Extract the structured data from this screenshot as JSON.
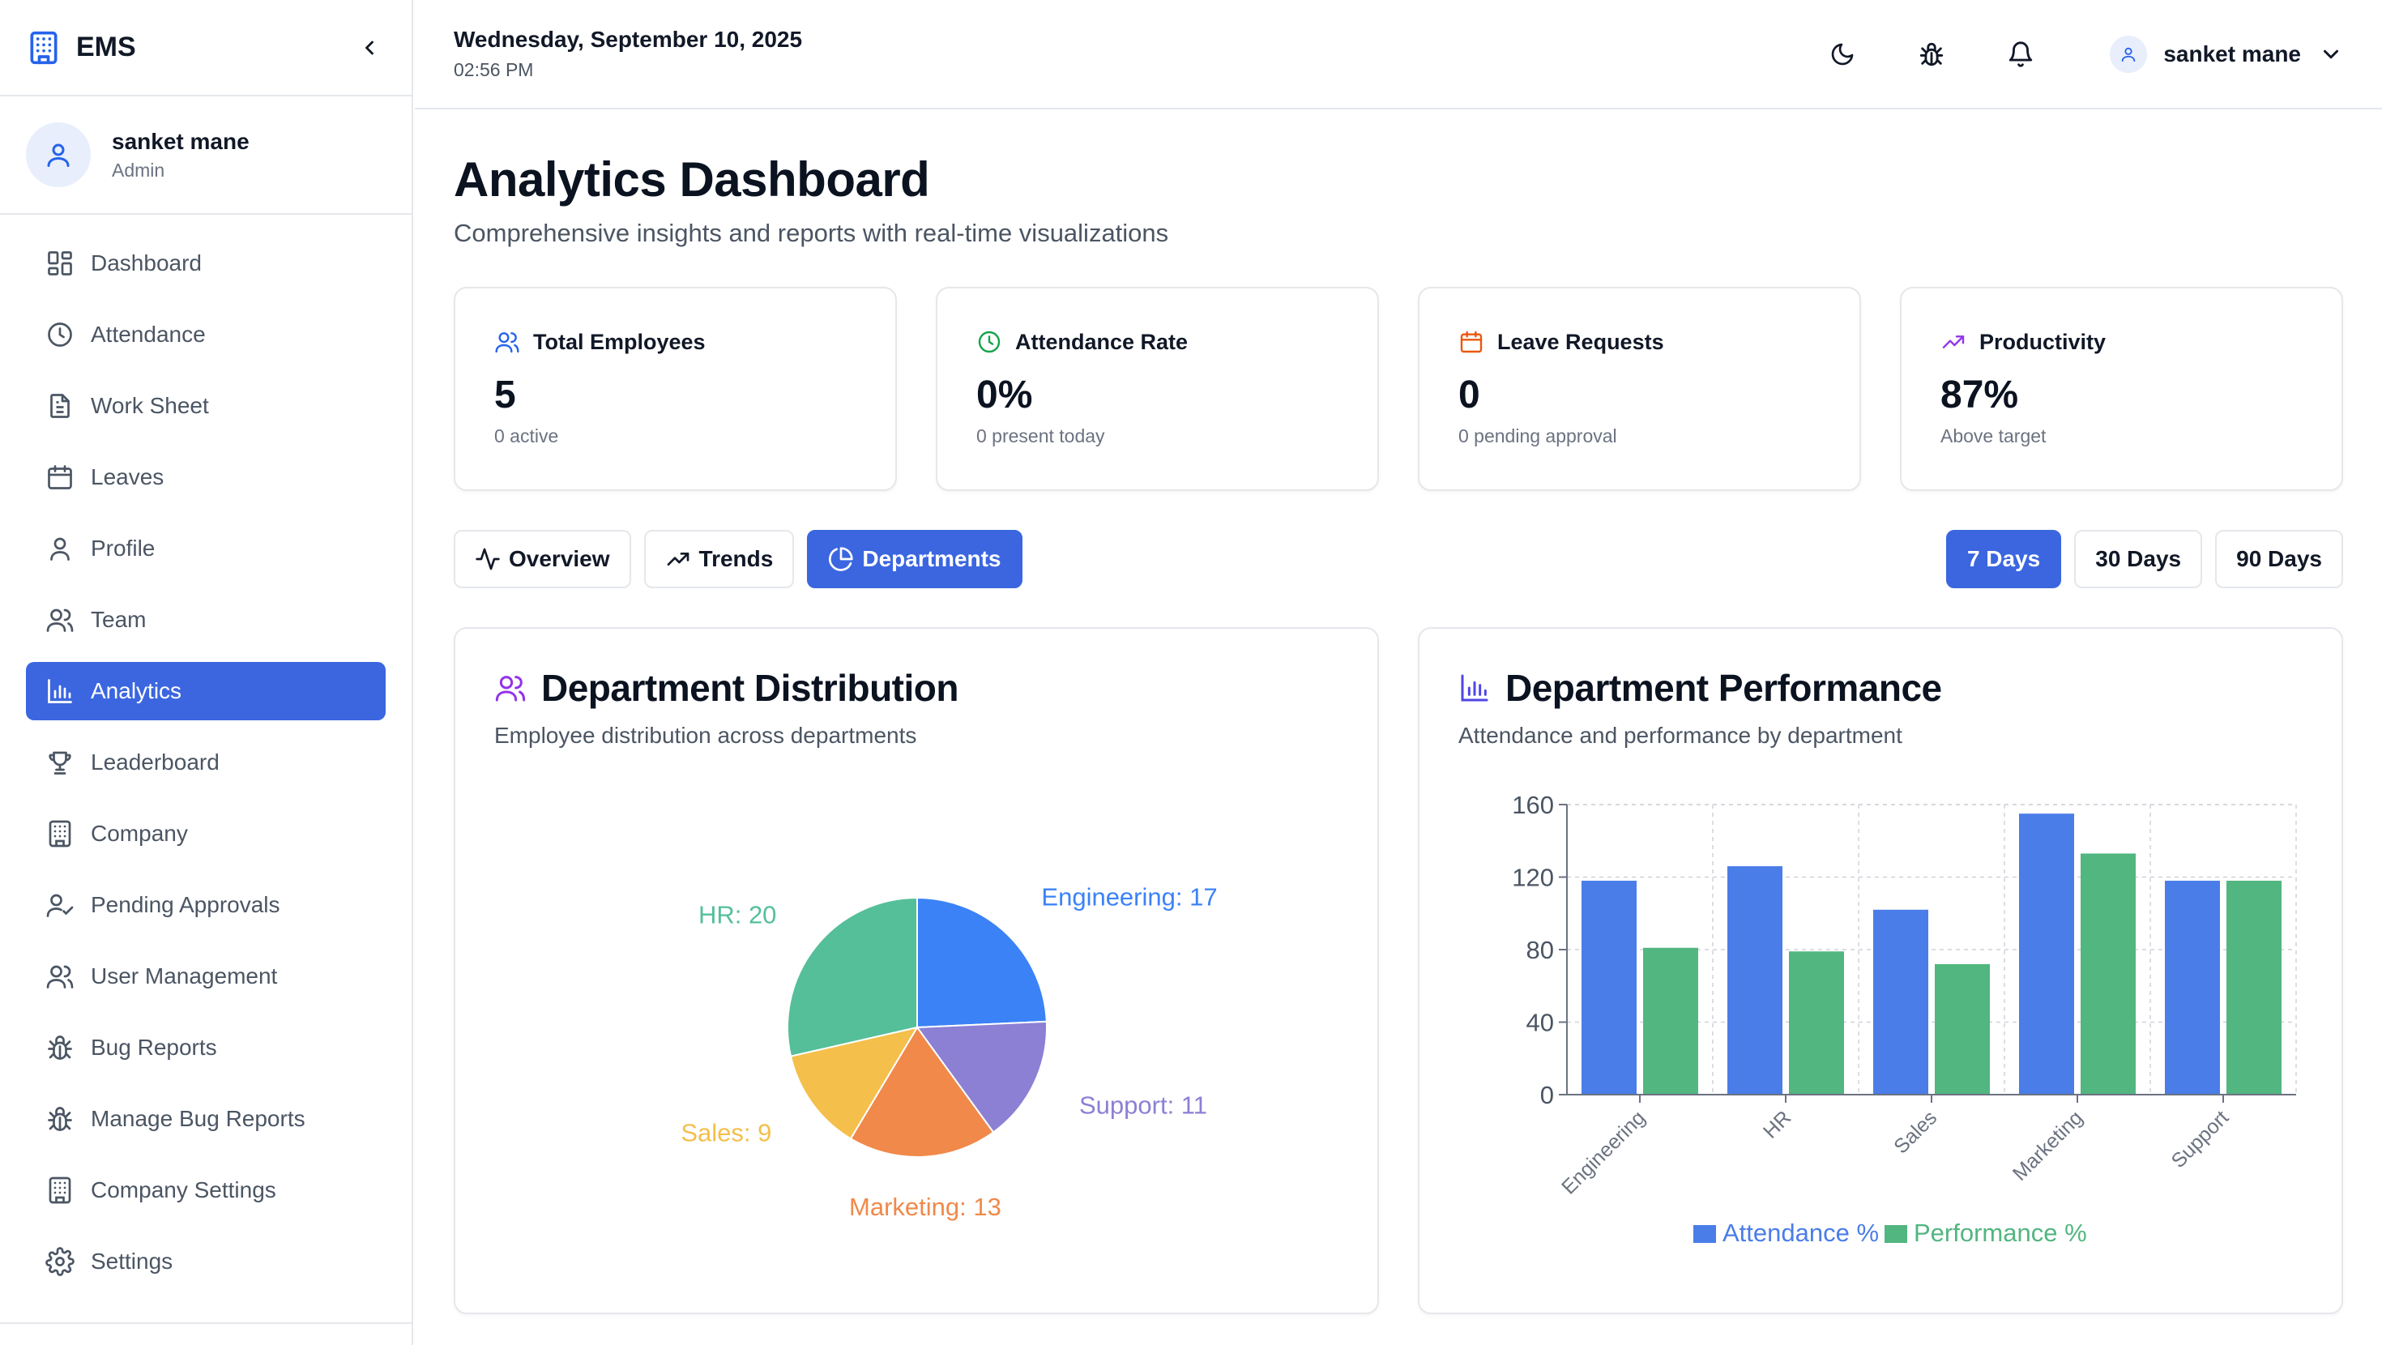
{
  "app": {
    "name": "EMS"
  },
  "user": {
    "name": "sanket mane",
    "role": "Admin"
  },
  "sidebar": {
    "items": [
      {
        "label": "Dashboard",
        "icon": "dashboard-icon"
      },
      {
        "label": "Attendance",
        "icon": "clock-icon"
      },
      {
        "label": "Work Sheet",
        "icon": "document-icon"
      },
      {
        "label": "Leaves",
        "icon": "calendar-icon"
      },
      {
        "label": "Profile",
        "icon": "user-icon"
      },
      {
        "label": "Team",
        "icon": "users-icon"
      },
      {
        "label": "Analytics",
        "icon": "bar-chart-icon",
        "active": true
      },
      {
        "label": "Leaderboard",
        "icon": "trophy-icon"
      },
      {
        "label": "Company",
        "icon": "building-icon"
      },
      {
        "label": "Pending Approvals",
        "icon": "user-check-icon"
      },
      {
        "label": "User Management",
        "icon": "users-icon"
      },
      {
        "label": "Bug Reports",
        "icon": "bug-icon"
      },
      {
        "label": "Manage Bug Reports",
        "icon": "bug-icon"
      },
      {
        "label": "Company Settings",
        "icon": "building-icon"
      },
      {
        "label": "Settings",
        "icon": "gear-icon"
      }
    ]
  },
  "header": {
    "date": "Wednesday, September 10, 2025",
    "time": "02:56 PM",
    "user_name": "sanket mane",
    "icons": [
      "moon-icon",
      "bug-icon",
      "bell-icon"
    ]
  },
  "page": {
    "title": "Analytics Dashboard",
    "subtitle": "Comprehensive insights and reports with real-time visualizations"
  },
  "stats": [
    {
      "title": "Total Employees",
      "value": "5",
      "sub": "0 active",
      "icon": "users-icon",
      "color": "#2563eb"
    },
    {
      "title": "Attendance Rate",
      "value": "0%",
      "sub": "0 present today",
      "icon": "clock-icon",
      "color": "#16a34a"
    },
    {
      "title": "Leave Requests",
      "value": "0",
      "sub": "0 pending approval",
      "icon": "calendar-icon",
      "color": "#ea580c"
    },
    {
      "title": "Productivity",
      "value": "87%",
      "sub": "Above target",
      "icon": "trending-up-icon",
      "color": "#9333ea"
    }
  ],
  "tabs": [
    {
      "label": "Overview",
      "icon": "activity-icon"
    },
    {
      "label": "Trends",
      "icon": "trending-up-icon"
    },
    {
      "label": "Departments",
      "icon": "pie-icon",
      "active": true
    }
  ],
  "ranges": [
    {
      "label": "7 Days",
      "active": true
    },
    {
      "label": "30 Days"
    },
    {
      "label": "90 Days"
    }
  ],
  "panels": {
    "distribution": {
      "title": "Department Distribution",
      "subtitle": "Employee distribution across departments",
      "icon": "users-icon",
      "icon_color": "#9333ea"
    },
    "performance": {
      "title": "Department Performance",
      "subtitle": "Attendance and performance by department",
      "icon": "bar-chart-icon",
      "icon_color": "#4f46e5"
    }
  },
  "chart_data": [
    {
      "type": "pie",
      "title": "Department Distribution",
      "slices": [
        {
          "label": "Engineering",
          "value": 17,
          "color": "#3b82f6",
          "display": "Engineering: 17"
        },
        {
          "label": "Support",
          "value": 11,
          "color": "#8b80d4",
          "display": "Support: 11"
        },
        {
          "label": "Marketing",
          "value": 13,
          "color": "#f0894a",
          "display": "Marketing: 13"
        },
        {
          "label": "Sales",
          "value": 9,
          "color": "#f4bf4a",
          "display": "Sales: 9"
        },
        {
          "label": "HR",
          "value": 20,
          "color": "#55bf9a",
          "display": "HR: 20"
        }
      ]
    },
    {
      "type": "bar",
      "title": "Department Performance",
      "categories": [
        "Engineering",
        "HR",
        "Sales",
        "Marketing",
        "Support"
      ],
      "series": [
        {
          "name": "Attendance %",
          "values": [
            118,
            126,
            102,
            155,
            118
          ],
          "color": "#4a7de8"
        },
        {
          "name": "Performance %",
          "values": [
            81,
            79,
            72,
            133,
            118
          ],
          "color": "#52b680"
        }
      ],
      "yticks": [
        0,
        40,
        80,
        120,
        160
      ],
      "ylim": [
        0,
        160
      ],
      "grid": true,
      "legend_position": "bottom"
    }
  ]
}
